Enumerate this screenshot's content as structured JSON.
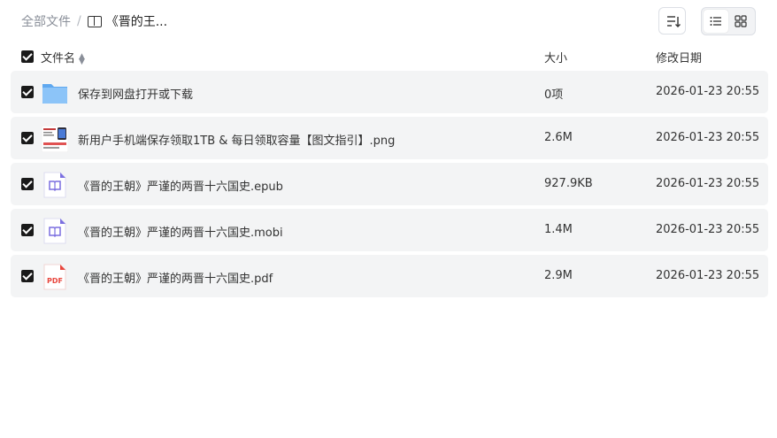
{
  "breadcrumb": {
    "root": "全部文件",
    "separator": "/",
    "current": "《晋的王..."
  },
  "toolbar": {
    "sort_icon": "sort-list-icon",
    "list_view_icon": "list-view-icon",
    "grid_view_icon": "grid-view-icon",
    "active_view": "list"
  },
  "columns": {
    "name": "文件名",
    "size": "大小",
    "date": "修改日期"
  },
  "files": [
    {
      "name": "保存到网盘打开或下载",
      "size": "0项",
      "date": "2026-01-23 20:55",
      "icon": "folder-icon"
    },
    {
      "name": "新用户手机端保存领取1TB & 每日领取容量【图文指引】.png",
      "size": "2.6M",
      "date": "2026-01-23 20:55",
      "icon": "image-thumbnail"
    },
    {
      "name": "《晋的王朝》严谨的两晋十六国史.epub",
      "size": "927.9KB",
      "date": "2026-01-23 20:55",
      "icon": "ebook-icon"
    },
    {
      "name": "《晋的王朝》严谨的两晋十六国史.mobi",
      "size": "1.4M",
      "date": "2026-01-23 20:55",
      "icon": "ebook-icon"
    },
    {
      "name": "《晋的王朝》严谨的两晋十六国史.pdf",
      "size": "2.9M",
      "date": "2026-01-23 20:55",
      "icon": "pdf-icon",
      "icon_label": "PDF"
    }
  ],
  "colors": {
    "row_bg": "#f3f4f5",
    "checkbox": "#1a1a1a",
    "folder": "#7cb8f5",
    "ebook": "#7b6fe0",
    "pdf": "#e8453c"
  }
}
